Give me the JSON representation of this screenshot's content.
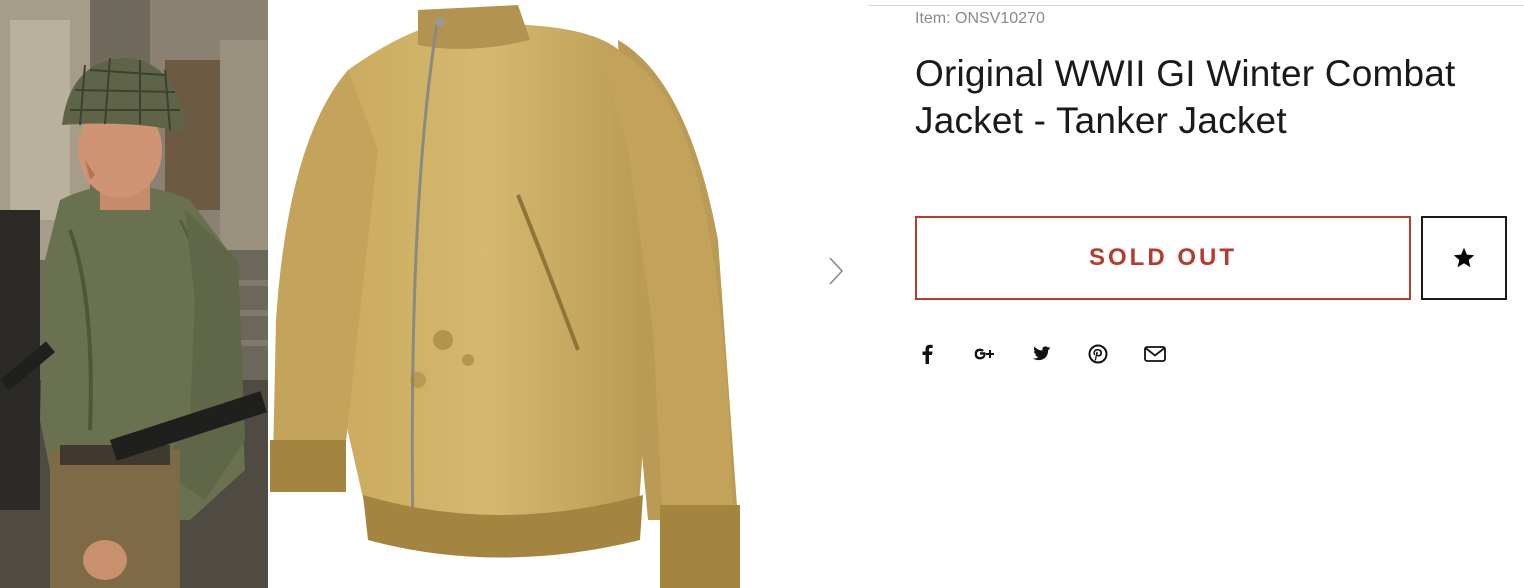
{
  "product": {
    "item_code": "Item: ONSV10270",
    "title": "Original WWII GI Winter Combat Jacket - Tanker Jacket",
    "availability_label": "SOLD OUT"
  },
  "gallery": {
    "thumbnail_subject": "soldier-in-tanker-jacket-photo",
    "main_image_subject": "tan-zip-jacket-photo",
    "next_icon": "chevron-right-icon"
  },
  "wishlist": {
    "icon": "star-icon"
  },
  "share": {
    "icons": [
      "facebook-icon",
      "google-plus-icon",
      "twitter-icon",
      "pinterest-icon",
      "email-icon"
    ]
  },
  "colors": {
    "sold_out": "#b83a2b",
    "text": "#1a1a1a",
    "muted": "#8a8a8a",
    "jacket": "#c7a95e"
  }
}
